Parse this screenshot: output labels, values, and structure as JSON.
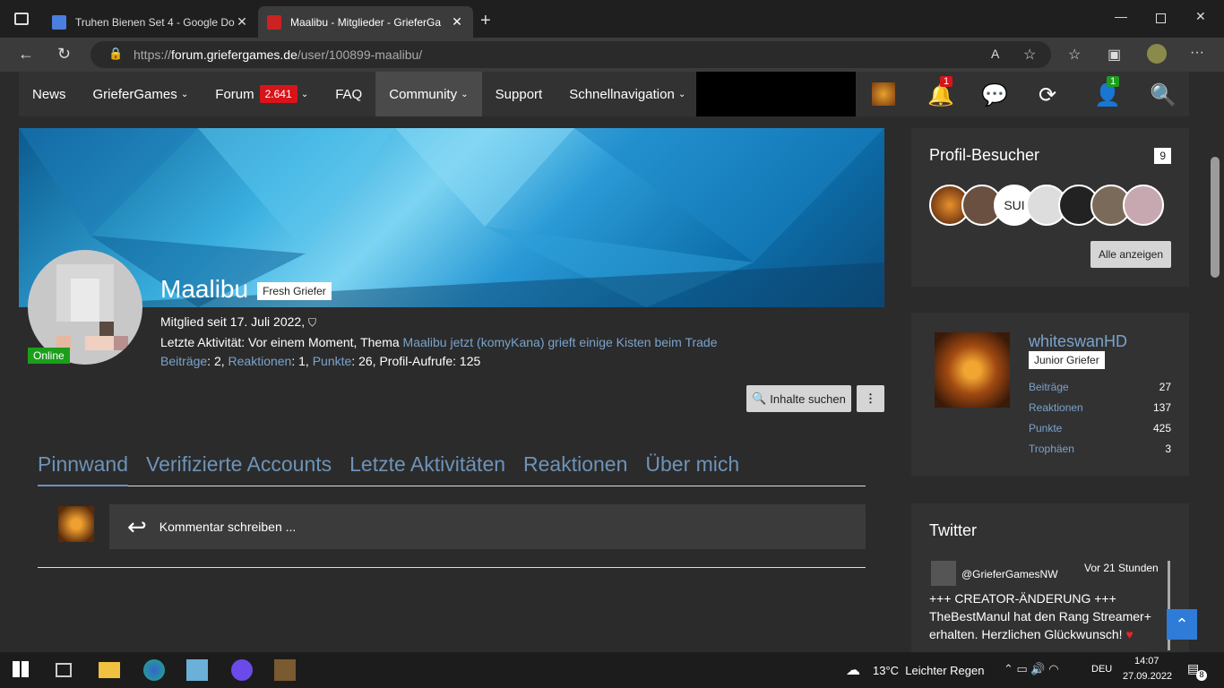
{
  "browser": {
    "tabs": [
      {
        "title": "Truhen Bienen Set 4 - Google Do",
        "close": "✕"
      },
      {
        "title": "Maalibu - Mitglieder - GrieferGa",
        "close": "✕"
      }
    ],
    "url_prefix": "https://",
    "url_domain": "forum.griefergames.de",
    "url_path": "/user/100899-maalibu/"
  },
  "nav": {
    "items": [
      "News",
      "GrieferGames",
      "Forum",
      "FAQ",
      "Community",
      "Support",
      "Schnellnavigation"
    ],
    "forum_badge": "2.641",
    "notif_badge": "1",
    "user_badge": "1"
  },
  "profile": {
    "name": "Maalibu",
    "rank": "Fresh Griefer",
    "online": "Online",
    "member_since": "Mitglied seit 17. Juli 2022,",
    "last_activity_label": "Letzte Aktivität: Vor einem Moment, Thema",
    "last_activity_link": "Maalibu jetzt (komyKana) grieft einige Kisten beim Trade",
    "stats": {
      "posts_label": "Beiträge",
      "posts": "2",
      "reactions_label": "Reaktionen",
      "reactions": "1",
      "points_label": "Punkte",
      "points": "26",
      "views_label": "Profil-Aufrufe",
      "views": "125"
    },
    "search_btn": "Inhalte suchen",
    "more_btn": "⋮"
  },
  "tabs": [
    "Pinnwand",
    "Verifizierte Accounts",
    "Letzte Aktivitäten",
    "Reaktionen",
    "Über mich"
  ],
  "comment_placeholder": "Kommentar schreiben ...",
  "visitors": {
    "title": "Profil-Besucher",
    "count": "9",
    "sui": "SUI",
    "show_all": "Alle anzeigen"
  },
  "featured": {
    "name": "whiteswanHD",
    "rank": "Junior Griefer",
    "stats": [
      {
        "label": "Beiträge",
        "value": "27"
      },
      {
        "label": "Reaktionen",
        "value": "137"
      },
      {
        "label": "Punkte",
        "value": "425"
      },
      {
        "label": "Trophäen",
        "value": "3"
      }
    ]
  },
  "twitter": {
    "title": "Twitter",
    "handle": "@GrieferGamesNW",
    "time": "Vor 21 Stunden",
    "text1": "+++ CREATOR-ÄNDERUNG +++",
    "text2": "TheBestManul hat den Rang Streamer+",
    "text3": "erhalten. Herzlichen Glückwunsch!"
  },
  "taskbar": {
    "weather": "13°C  Leichter Regen",
    "lang": "DEU",
    "time": "14:07",
    "date": "27.09.2022",
    "notif": "8"
  },
  "colors": {
    "accent_link": "#7aa3cc",
    "badge_red": "#d7141a",
    "online_green": "#1b9e1b",
    "badge_green": "#1b9e1b"
  }
}
